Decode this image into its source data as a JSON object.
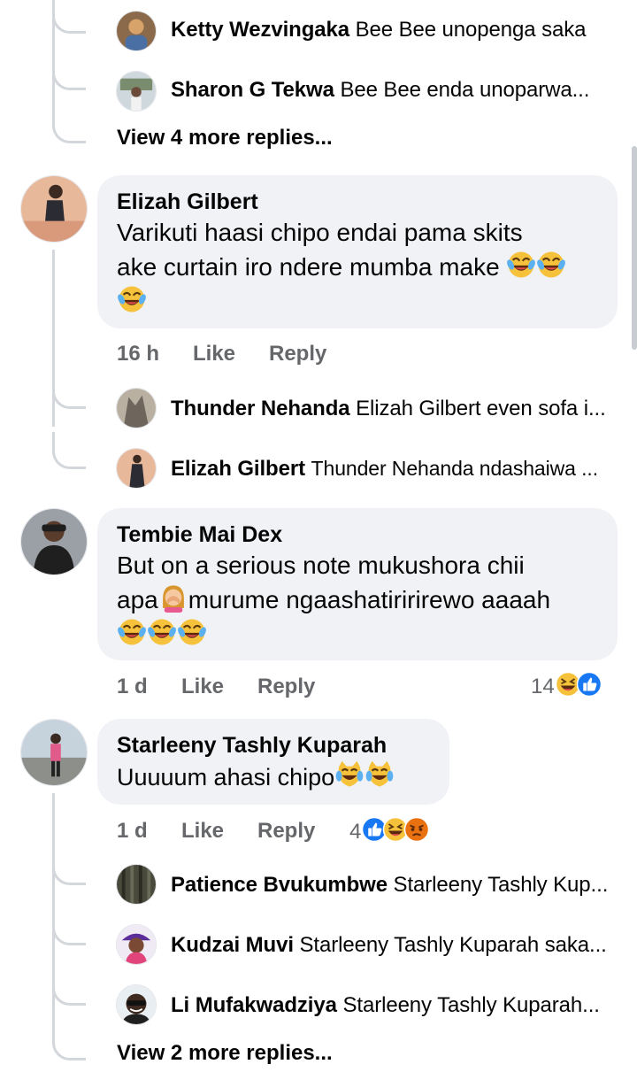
{
  "thread_top": {
    "replies": [
      {
        "name": "Ketty Wezvingaka",
        "text": "Bee Bee unopenga saka"
      },
      {
        "name": "Sharon G Tekwa",
        "text": "Bee Bee enda unoparwa..."
      }
    ],
    "view_more": "View 4 more replies..."
  },
  "comments": [
    {
      "author": "Elizah Gilbert",
      "text_line1": "Varikuti haasi chipo endai pama skits",
      "text_line2": "ake curtain iro ndere mumba make",
      "time": "16 h",
      "like": "Like",
      "reply": "Reply",
      "replies": [
        {
          "name": "Thunder Nehanda",
          "text": "Elizah Gilbert even sofa i..."
        },
        {
          "name": "Elizah Gilbert",
          "text": "Thunder Nehanda ndashaiwa ..."
        }
      ]
    },
    {
      "author": "Tembie Mai Dex",
      "text_line1": "But on a serious note mukushora chii",
      "text_line2a": "apa",
      "text_line2b": "murume ngaashatiririrewo aaaah",
      "time": "1 d",
      "like": "Like",
      "reply": "Reply",
      "reaction_count": "14"
    },
    {
      "author": "Starleeny Tashly Kuparah",
      "text": "Uuuuum ahasi chipo",
      "time": "1 d",
      "like": "Like",
      "reply": "Reply",
      "reaction_count": "4",
      "replies": [
        {
          "name": "Patience Bvukumbwe",
          "text": "Starleeny Tashly Kup..."
        },
        {
          "name": "Kudzai Muvi",
          "text": "Starleeny Tashly Kuparah saka..."
        },
        {
          "name": "Li Mufakwadziya",
          "text": "Starleeny Tashly Kuparah..."
        }
      ],
      "view_more": "View 2 more replies..."
    }
  ],
  "icons": {
    "laugh": "laughing-crying-emoji-icon",
    "cat": "cat-tears-of-joy-emoji-icon",
    "facepalm": "woman-facepalming-emoji-icon",
    "like": "like-reaction-icon",
    "haha": "haha-reaction-icon",
    "angry": "angry-reaction-icon"
  },
  "colors": {
    "bubble": "#f0f2f5",
    "meta_text": "#65676b",
    "thread_line": "#d3d6db",
    "like_blue": "#1877f2",
    "emoji_yellow": "#f7c23b",
    "angry_red": "#e9710f"
  }
}
